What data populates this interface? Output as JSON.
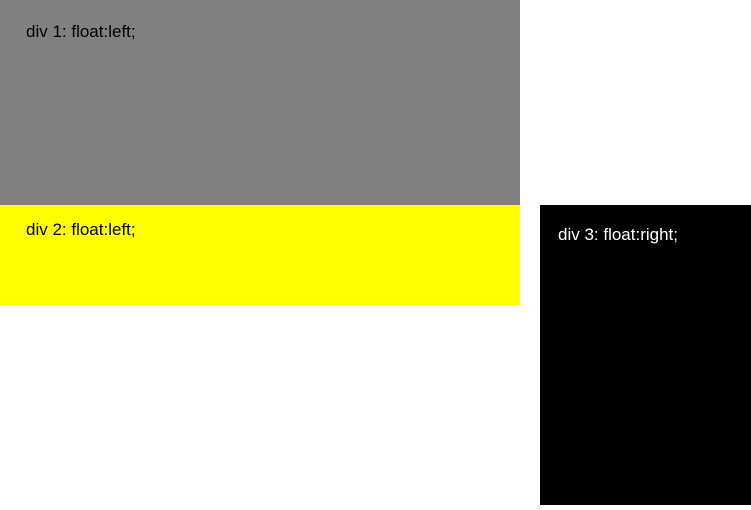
{
  "boxes": {
    "div1": {
      "label": "div 1: float:left;"
    },
    "div2": {
      "label": "div 2: float:left;"
    },
    "div3": {
      "label": "div 3: float:right;"
    }
  }
}
